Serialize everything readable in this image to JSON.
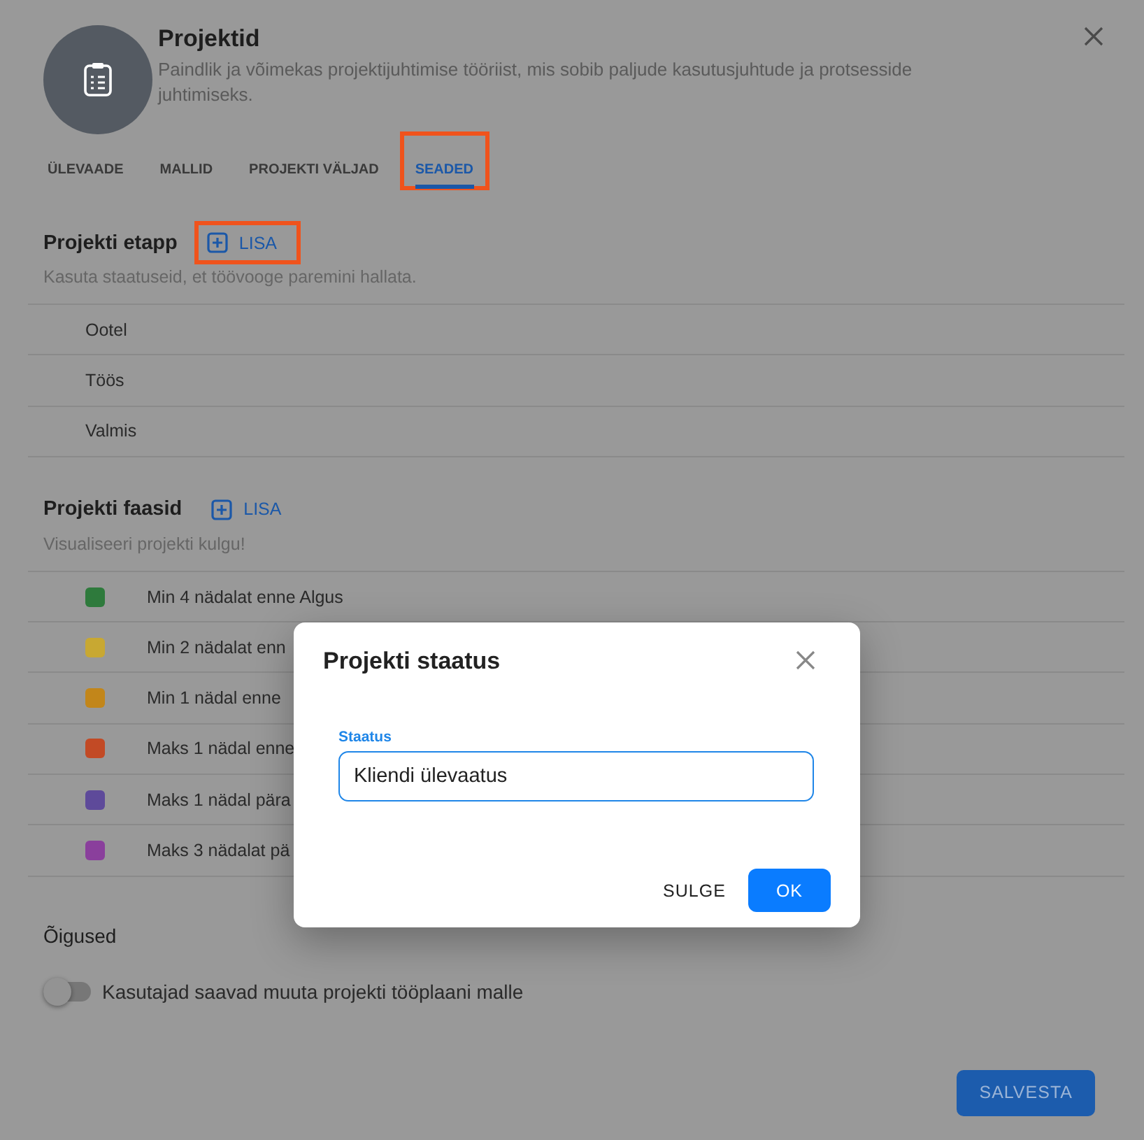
{
  "app": {
    "title": "Projektid",
    "description": "Paindlik ja võimekas projektijuhtimise tööriist, mis sobib paljude kasutusjuhtude ja protsesside juhtimiseks."
  },
  "tabs": [
    {
      "label": "ÜLEVAADE",
      "selected": false,
      "highlighted": false
    },
    {
      "label": "MALLID",
      "selected": false,
      "highlighted": false
    },
    {
      "label": "PROJEKTI VÄLJAD",
      "selected": false,
      "highlighted": false
    },
    {
      "label": "SEADED",
      "selected": true,
      "highlighted": true
    }
  ],
  "stages": {
    "title": "Projekti etapp",
    "add_button": {
      "label": "LISA",
      "highlighted": true
    },
    "subtitle": "Kasuta staatuseid, et töövooge paremini hallata.",
    "items": [
      "Ootel",
      "Töös",
      "Valmis"
    ]
  },
  "phases": {
    "title": "Projekti faasid",
    "add_button": {
      "label": "LISA",
      "highlighted": false
    },
    "subtitle": "Visualiseeri projekti kulgu!",
    "items": [
      {
        "label": "Min 4 nädalat enne Algus",
        "color": "#2e7a3c"
      },
      {
        "label": "Min 2 nädalat enn",
        "color": "#c8a832"
      },
      {
        "label": "Min 1 nädal enne",
        "color": "#c2861a"
      },
      {
        "label": "Maks 1 nädal enne",
        "color": "#c24a25"
      },
      {
        "label": "Maks 1 nädal pära",
        "color": "#5e4a9a"
      },
      {
        "label": "Maks 3 nädalat pä",
        "color": "#8a3f9c"
      }
    ]
  },
  "permissions": {
    "title": "Õigused",
    "toggles": [
      {
        "label": "Kasutajad saavad muuta projekti tööplaani malle",
        "on": false
      }
    ]
  },
  "save_button": "SALVESTA",
  "dialog": {
    "title": "Projekti staatus",
    "field": {
      "label": "Staatus",
      "value": "Kliendi ülevaatus"
    },
    "buttons": [
      {
        "label": "SULGE",
        "kind": "text"
      },
      {
        "label": "OK",
        "kind": "primary"
      }
    ]
  }
}
